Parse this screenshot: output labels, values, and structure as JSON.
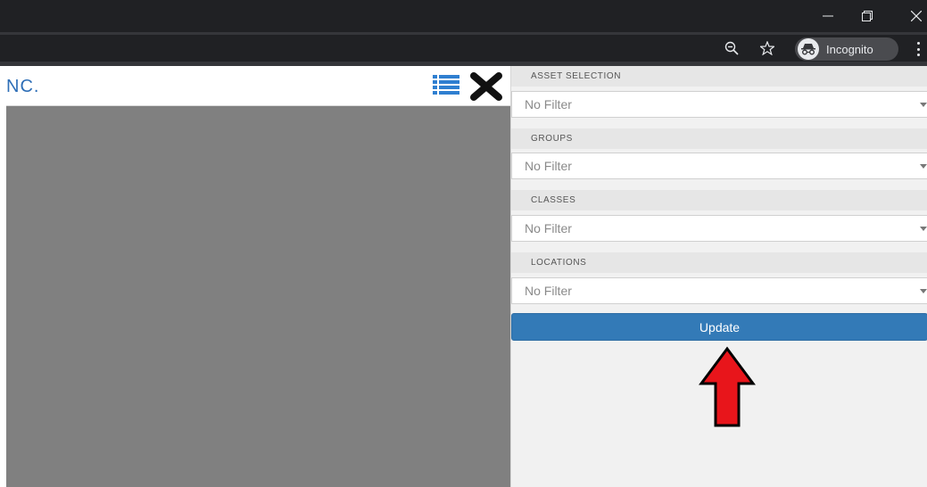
{
  "browser": {
    "incognito_label": "Incognito"
  },
  "app": {
    "brand": "NC."
  },
  "filters": [
    {
      "label": "ASSET SELECTION",
      "value": "No Filter"
    },
    {
      "label": "GROUPS",
      "value": "No Filter"
    },
    {
      "label": "CLASSES",
      "value": "No Filter"
    },
    {
      "label": "LOCATIONS",
      "value": "No Filter"
    }
  ],
  "panel": {
    "update_label": "Update"
  },
  "colors": {
    "accent": "#337ab7",
    "brand": "#2f6fb7",
    "arrow": "#e8151b",
    "map": "#808080"
  },
  "icons": [
    "minimize-icon",
    "restore-icon",
    "close-window-icon",
    "zoom-out-icon",
    "star-icon",
    "incognito-icon",
    "kebab-menu-icon",
    "list-icon",
    "close-icon",
    "arrow-up-icon"
  ]
}
